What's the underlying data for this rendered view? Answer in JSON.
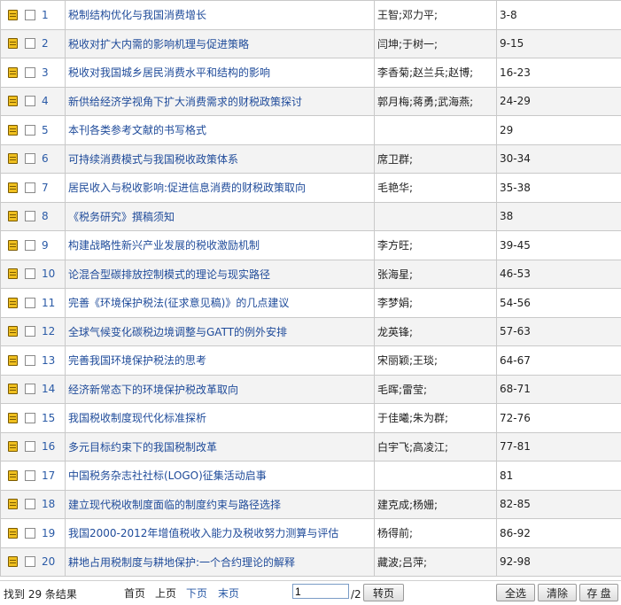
{
  "articles": [
    {
      "num": "1",
      "title": "税制结构优化与我国消费增长",
      "authors": "王智;邓力平;",
      "pages": "3-8"
    },
    {
      "num": "2",
      "title": "税收对扩大内需的影响机理与促进策略",
      "authors": "闫坤;于树一;",
      "pages": "9-15"
    },
    {
      "num": "3",
      "title": "税收对我国城乡居民消费水平和结构的影响",
      "authors": "李香菊;赵兰兵;赵博;",
      "pages": "16-23"
    },
    {
      "num": "4",
      "title": "新供给经济学视角下扩大消费需求的财税政策探讨",
      "authors": "郭月梅;蒋勇;武海燕;",
      "pages": "24-29"
    },
    {
      "num": "5",
      "title": "本刊各类参考文献的书写格式",
      "authors": "",
      "pages": "29"
    },
    {
      "num": "6",
      "title": "可持续消费模式与我国税收政策体系",
      "authors": "席卫群;",
      "pages": "30-34"
    },
    {
      "num": "7",
      "title": "居民收入与税收影响:促进信息消费的财税政策取向",
      "authors": "毛艳华;",
      "pages": "35-38"
    },
    {
      "num": "8",
      "title": "《税务研究》撰稿须知",
      "authors": "",
      "pages": "38"
    },
    {
      "num": "9",
      "title": "构建战略性新兴产业发展的税收激励机制",
      "authors": "李方旺;",
      "pages": "39-45"
    },
    {
      "num": "10",
      "title": "论混合型碳排放控制模式的理论与现实路径",
      "authors": "张海星;",
      "pages": "46-53"
    },
    {
      "num": "11",
      "title": "完善《环境保护税法(征求意见稿)》的几点建议",
      "authors": "李梦娟;",
      "pages": "54-56"
    },
    {
      "num": "12",
      "title": "全球气候变化碳税边境调整与GATT的例外安排",
      "authors": "龙英锋;",
      "pages": "57-63"
    },
    {
      "num": "13",
      "title": "完善我国环境保护税法的思考",
      "authors": "宋丽颖;王琰;",
      "pages": "64-67"
    },
    {
      "num": "14",
      "title": "经济新常态下的环境保护税改革取向",
      "authors": "毛晖;雷莹;",
      "pages": "68-71"
    },
    {
      "num": "15",
      "title": "我国税收制度现代化标准探析",
      "authors": "于佳曦;朱为群;",
      "pages": "72-76"
    },
    {
      "num": "16",
      "title": "多元目标约束下的我国税制改革",
      "authors": "白宇飞;高凌江;",
      "pages": "77-81"
    },
    {
      "num": "17",
      "title": "中国税务杂志社社标(LOGO)征集活动启事",
      "authors": "",
      "pages": "81"
    },
    {
      "num": "18",
      "title": "建立现代税收制度面临的制度约束与路径选择",
      "authors": "建克成;杨姗;",
      "pages": "82-85"
    },
    {
      "num": "19",
      "title": "我国2000-2012年增值税收入能力及税收努力测算与评估",
      "authors": "杨得前;",
      "pages": "86-92"
    },
    {
      "num": "20",
      "title": "耕地占用税制度与耕地保护:一个合约理论的解释",
      "authors": "藏波;吕萍;",
      "pages": "92-98"
    }
  ],
  "icons": {
    "article": "document-icon",
    "select": "checkbox"
  },
  "footer": {
    "result_text": "找到 29 条结果",
    "first": "首页",
    "prev": "上页",
    "next": "下页",
    "last": "末页",
    "page_value": "1",
    "page_total": "/2",
    "goto": "转页",
    "select_all": "全选",
    "clear": "清除",
    "save": "存 盘"
  },
  "colors": {
    "link": "#1f4b9a",
    "row_alt": "#f3f3f3",
    "icon": "#f0c020"
  }
}
